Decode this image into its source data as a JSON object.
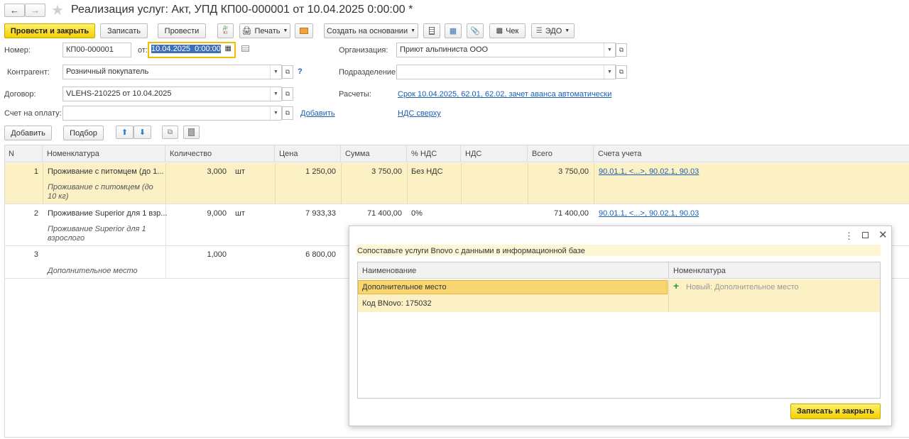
{
  "window": {
    "title": "Реализация услуг: Акт, УПД КП00-000001 от 10.04.2025 0:00:00 *"
  },
  "toolbar": {
    "post_close": "Провести и закрыть",
    "save": "Записать",
    "post": "Провести",
    "dtkt_top": "Дт",
    "dtkt_bottom": "Кт",
    "print": "Печать",
    "create_based": "Создать на основании",
    "check": "Чек",
    "edo": "ЭДО"
  },
  "form": {
    "number_label": "Номер:",
    "number_value": "КП00-000001",
    "date_label": "от:",
    "date_value": "10.04.2025  0:00:00",
    "contractor_label": "Контрагент:",
    "contractor_value": "Розничный покупатель",
    "contract_label": "Договор:",
    "contract_value": "VLEHS-210225 от 10.04.2025",
    "invoice_label": "Счет на оплату:",
    "invoice_value": "",
    "add_link": "Добавить",
    "org_label": "Организация:",
    "org_value": "Приют альпиниста ООО",
    "dept_label": "Подразделение:",
    "dept_value": "",
    "settlements_label": "Расчеты:",
    "settlements_link": "Срок 10.04.2025, 62.01, 62.02, зачет аванса автоматически",
    "vat_link": "НДС сверху",
    "help": "?"
  },
  "table_toolbar": {
    "add": "Добавить",
    "pick": "Подбор"
  },
  "table": {
    "columns": [
      "N",
      "Номенклатура",
      "Количество",
      "Цена",
      "Сумма",
      "% НДС",
      "НДС",
      "Всего",
      "Счета учета"
    ],
    "rows": [
      {
        "n": "1",
        "name": "Проживание с питомцем (до 1...",
        "sub": "Проживание с питомцем (до 10 кг)",
        "qty": "3,000",
        "unit": "шт",
        "price": "1 250,00",
        "sum": "3 750,00",
        "vat_rate": "Без НДС",
        "vat": "",
        "total": "3 750,00",
        "accounts": "90.01.1, <...>, 90.02.1, 90.03"
      },
      {
        "n": "2",
        "name": "Проживание Superior для 1 взр...",
        "sub": "Проживание Superior для 1 взрослого",
        "qty": "9,000",
        "unit": "шт",
        "price": "7 933,33",
        "sum": "71 400,00",
        "vat_rate": "0%",
        "vat": "",
        "total": "71 400,00",
        "accounts": "90.01.1, <...>, 90.02.1, 90.03"
      },
      {
        "n": "3",
        "name": "",
        "sub": "Дополнительное место",
        "qty": "1,000",
        "unit": "",
        "price": "6 800,00",
        "sum": "",
        "vat_rate": "",
        "vat": "",
        "total": "",
        "accounts": ""
      }
    ]
  },
  "dialog": {
    "message": "Сопоставьте услуги Bnovo с данными в информационной базе",
    "col_name": "Наименование",
    "col_nomenclature": "Номенклатура",
    "row_name": "Дополнительное место",
    "row_code": "Код BNovo: 175032",
    "new_item": "Новый: Дополнительное место",
    "save_close": "Записать и закрыть"
  },
  "colors": {
    "accent_yellow": "#f4d000",
    "selection": "#fbf1c4",
    "link": "#1a5fb4"
  }
}
